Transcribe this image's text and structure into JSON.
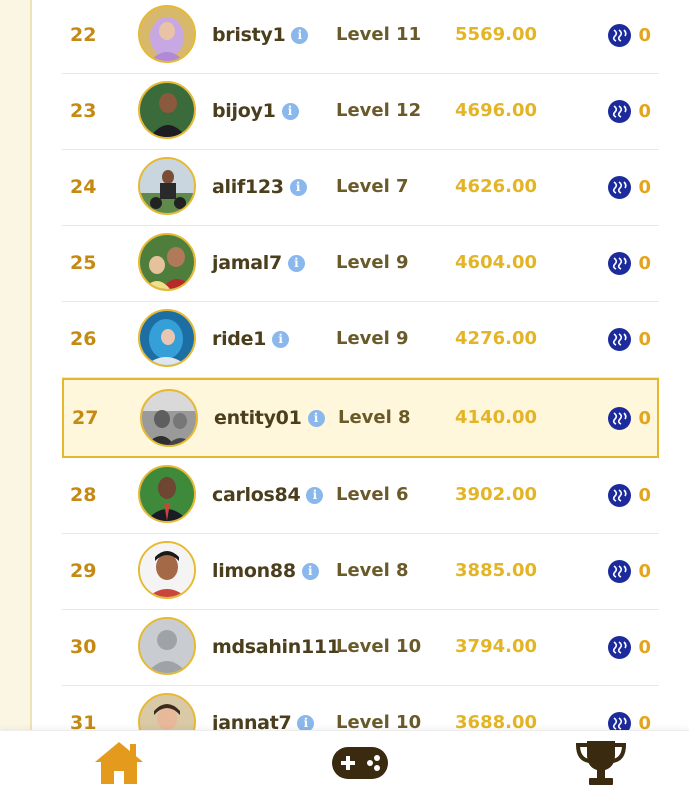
{
  "leaderboard": {
    "rows": [
      {
        "rank": "22",
        "username": "bristy1",
        "level": "Level 11",
        "score": "5569.00",
        "reward": "0",
        "avatar": "woman-hijab-avatar",
        "highlight": false
      },
      {
        "rank": "23",
        "username": "bijoy1",
        "level": "Level 12",
        "score": "4696.00",
        "reward": "0",
        "avatar": "man-dark-shirt-avatar",
        "highlight": false
      },
      {
        "rank": "24",
        "username": "alif123",
        "level": "Level 7",
        "score": "4626.00",
        "reward": "0",
        "avatar": "man-motorbike-avatar",
        "highlight": false
      },
      {
        "rank": "25",
        "username": "jamal7",
        "level": "Level 9",
        "score": "4604.00",
        "reward": "0",
        "avatar": "man-with-baby-avatar",
        "highlight": false
      },
      {
        "rank": "26",
        "username": "ride1",
        "level": "Level 9",
        "score": "4276.00",
        "reward": "0",
        "avatar": "blue-hijab-avatar",
        "highlight": false
      },
      {
        "rank": "27",
        "username": "entity01",
        "level": "Level 8",
        "score": "4140.00",
        "reward": "0",
        "avatar": "grayscale-man-avatar",
        "highlight": true
      },
      {
        "rank": "28",
        "username": "carlos84",
        "level": "Level 6",
        "score": "3902.00",
        "reward": "0",
        "avatar": "man-suit-avatar",
        "highlight": false
      },
      {
        "rank": "29",
        "username": "limon88",
        "level": "Level 8",
        "score": "3885.00",
        "reward": "0",
        "avatar": "young-man-avatar",
        "highlight": false
      },
      {
        "rank": "30",
        "username": "mdsahin111",
        "level": "Level 10",
        "score": "3794.00",
        "reward": "0",
        "avatar": "default-user-avatar",
        "highlight": false
      },
      {
        "rank": "31",
        "username": "jannat7",
        "level": "Level 10",
        "score": "3688.00",
        "reward": "0",
        "avatar": "girl-avatar",
        "highlight": false
      }
    ]
  },
  "icons": {
    "info": "info-icon",
    "coin": "steem-coin-icon"
  },
  "bottom_nav": {
    "items": [
      {
        "name": "home",
        "icon": "home-icon",
        "active": true
      },
      {
        "name": "games",
        "icon": "gamepad-icon",
        "active": false
      },
      {
        "name": "leaderboard",
        "icon": "trophy-icon",
        "active": false
      }
    ]
  },
  "colors": {
    "rank": "#c48a13",
    "score": "#e3b526",
    "highlight_border": "#e4b72c",
    "highlight_bg": "#fff7dc",
    "coin": "#1c2a9c",
    "info": "#8ab7ec",
    "home_icon": "#e39a1d",
    "nav_icon_dark": "#3a2a10"
  }
}
